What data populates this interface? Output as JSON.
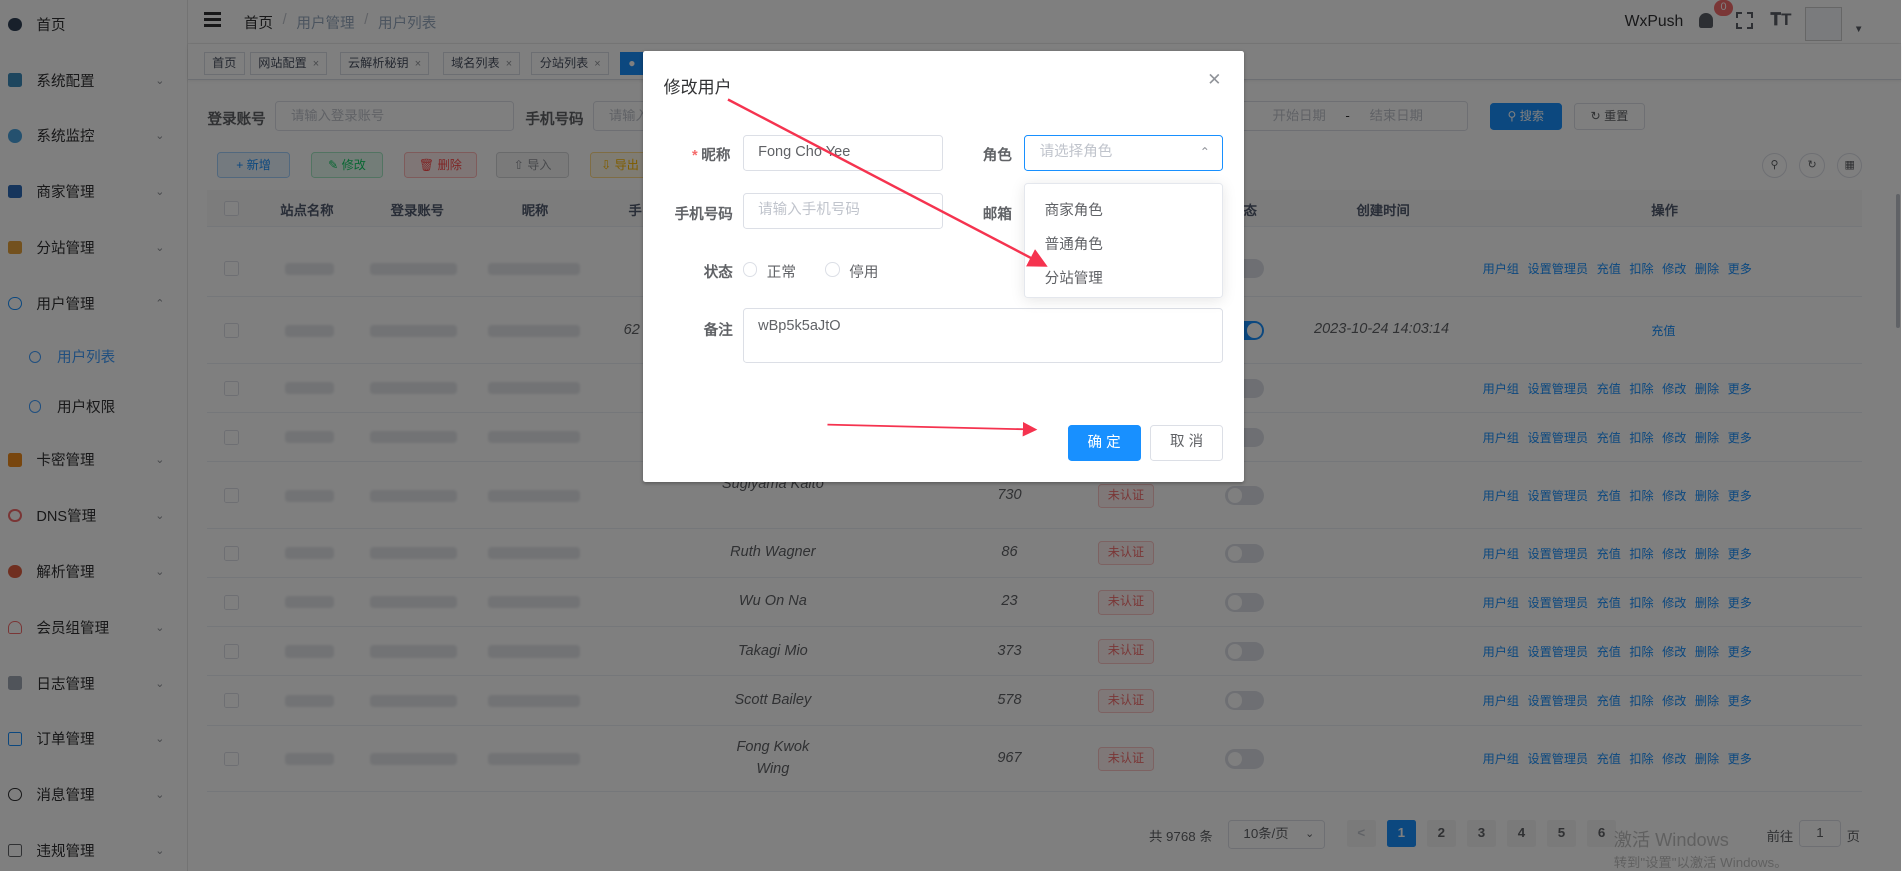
{
  "sidebar": {
    "items": [
      {
        "label": "首页",
        "icon": "dashboard-icon",
        "color": "#304156",
        "expandable": false
      },
      {
        "label": "系统配置",
        "icon": "settings-icon",
        "color": "#3c8dbc",
        "expandable": true
      },
      {
        "label": "系统监控",
        "icon": "monitor-icon",
        "color": "#4aa3df",
        "expandable": true
      },
      {
        "label": "商家管理",
        "icon": "shop-icon",
        "color": "#2c6bb8",
        "expandable": true
      },
      {
        "label": "分站管理",
        "icon": "station-icon",
        "color": "#e6a23c",
        "expandable": true
      },
      {
        "label": "用户管理",
        "icon": "user-icon",
        "color": "#1890ff",
        "expandable": true,
        "open": true
      },
      {
        "label": "卡密管理",
        "icon": "card-icon",
        "color": "#f08c1c",
        "expandable": true
      },
      {
        "label": "DNS管理",
        "icon": "dns-icon",
        "color": "#f56c6c",
        "expandable": true
      },
      {
        "label": "解析管理",
        "icon": "resolve-icon",
        "color": "#e15f41",
        "expandable": true
      },
      {
        "label": "会员组管理",
        "icon": "member-group-icon",
        "color": "#f56c6c",
        "expandable": true
      },
      {
        "label": "日志管理",
        "icon": "log-icon",
        "color": "#a0a8b5",
        "expandable": true
      },
      {
        "label": "订单管理",
        "icon": "order-icon",
        "color": "#1890ff",
        "expandable": true
      },
      {
        "label": "消息管理",
        "icon": "message-icon",
        "color": "#303133",
        "expandable": true
      },
      {
        "label": "违规管理",
        "icon": "violation-icon",
        "color": "#606266",
        "expandable": true
      }
    ],
    "submenu": [
      {
        "label": "用户列表",
        "icon": "user-list-icon",
        "active": true
      },
      {
        "label": "用户权限",
        "icon": "user-permission-icon",
        "active": false
      }
    ]
  },
  "header": {
    "breadcrumb": [
      "首页",
      "用户管理",
      "用户列表"
    ],
    "brand": "WxPush",
    "notification_count": "0"
  },
  "tags": [
    {
      "label": "首页",
      "closable": false
    },
    {
      "label": "网站配置",
      "closable": true
    },
    {
      "label": "云解析秘钥",
      "closable": true
    },
    {
      "label": "域名列表",
      "closable": true
    },
    {
      "label": "分站列表",
      "closable": true
    },
    {
      "label": "●",
      "closable": false,
      "active": true
    }
  ],
  "search": {
    "login_label": "登录账号",
    "login_placeholder": "请输入登录账号",
    "phone_label": "手机号码",
    "phone_placeholder": "请输入",
    "start_date": "开始日期",
    "date_sep": "-",
    "end_date": "结束日期",
    "search_btn": "搜索",
    "reset_btn": "重置"
  },
  "toolbar": {
    "add": "新增",
    "edit": "修改",
    "delete": "删除",
    "import": "导入",
    "export": "导出"
  },
  "table": {
    "columns": [
      "站点名称",
      "登录账号",
      "昵称",
      "手",
      "态",
      "创建时间",
      "操作"
    ],
    "rows": [
      {
        "nickname": "",
        "score": "",
        "status": "",
        "switch": false,
        "ops": "full"
      },
      {
        "nickname": "",
        "score": "",
        "status": "",
        "switch": true,
        "created": "2023-10-24 14:03:14",
        "ops": "charge"
      },
      {
        "nickname": "",
        "score": "",
        "status": "",
        "switch": false,
        "ops": "full"
      },
      {
        "nickname": "",
        "score": "",
        "status": "",
        "switch": false,
        "ops": "full"
      },
      {
        "nickname": "Sugiyama Kaito",
        "score": "730",
        "status": "未认证",
        "switch": false,
        "ops": "full"
      },
      {
        "nickname": "Ruth Wagner",
        "score": "86",
        "status": "未认证",
        "switch": false,
        "ops": "full"
      },
      {
        "nickname": "Wu On Na",
        "score": "23",
        "status": "未认证",
        "switch": false,
        "ops": "full"
      },
      {
        "nickname": "Takagi Mio",
        "score": "373",
        "status": "未认证",
        "switch": false,
        "ops": "full"
      },
      {
        "nickname": "Scott Bailey",
        "score": "578",
        "status": "未认证",
        "switch": false,
        "ops": "full"
      },
      {
        "nickname": "Fong Kwok Wing",
        "score": "967",
        "status": "未认证",
        "switch": false,
        "ops": "full"
      }
    ],
    "partial_phone": "62",
    "ops_full": [
      "用户组",
      "设置管理员",
      "充值",
      "扣除",
      "修改",
      "删除",
      "更多"
    ],
    "ops_charge": "充值"
  },
  "pagination": {
    "total": "共 9768 条",
    "page_size": "10条/页",
    "pages": [
      "1",
      "2",
      "3",
      "4",
      "5",
      "6"
    ],
    "current": "1",
    "goto_label": "前往",
    "goto_value": "1",
    "goto_suffix": "页"
  },
  "watermark": {
    "line1": "激活 Windows",
    "line2": "转到\"设置\"以激活 Windows。"
  },
  "dialog": {
    "title": "修改用户",
    "nickname_label": "昵称",
    "nickname_value": "Fong Cho Yee",
    "role_label": "角色",
    "role_placeholder": "请选择角色",
    "phone_label": "手机号码",
    "phone_placeholder": "请输入手机号码",
    "email_label": "邮箱",
    "status_label": "状态",
    "status_options": [
      "正常",
      "停用"
    ],
    "remark_label": "备注",
    "remark_value": "wBp5k5aJtO",
    "ok": "确 定",
    "cancel": "取 消",
    "role_options": [
      "商家角色",
      "普通角色",
      "分站管理"
    ]
  },
  "colors": {
    "primary": "#1890ff",
    "danger": "#f56c6c",
    "annotation_arrow": "#f5334f"
  }
}
